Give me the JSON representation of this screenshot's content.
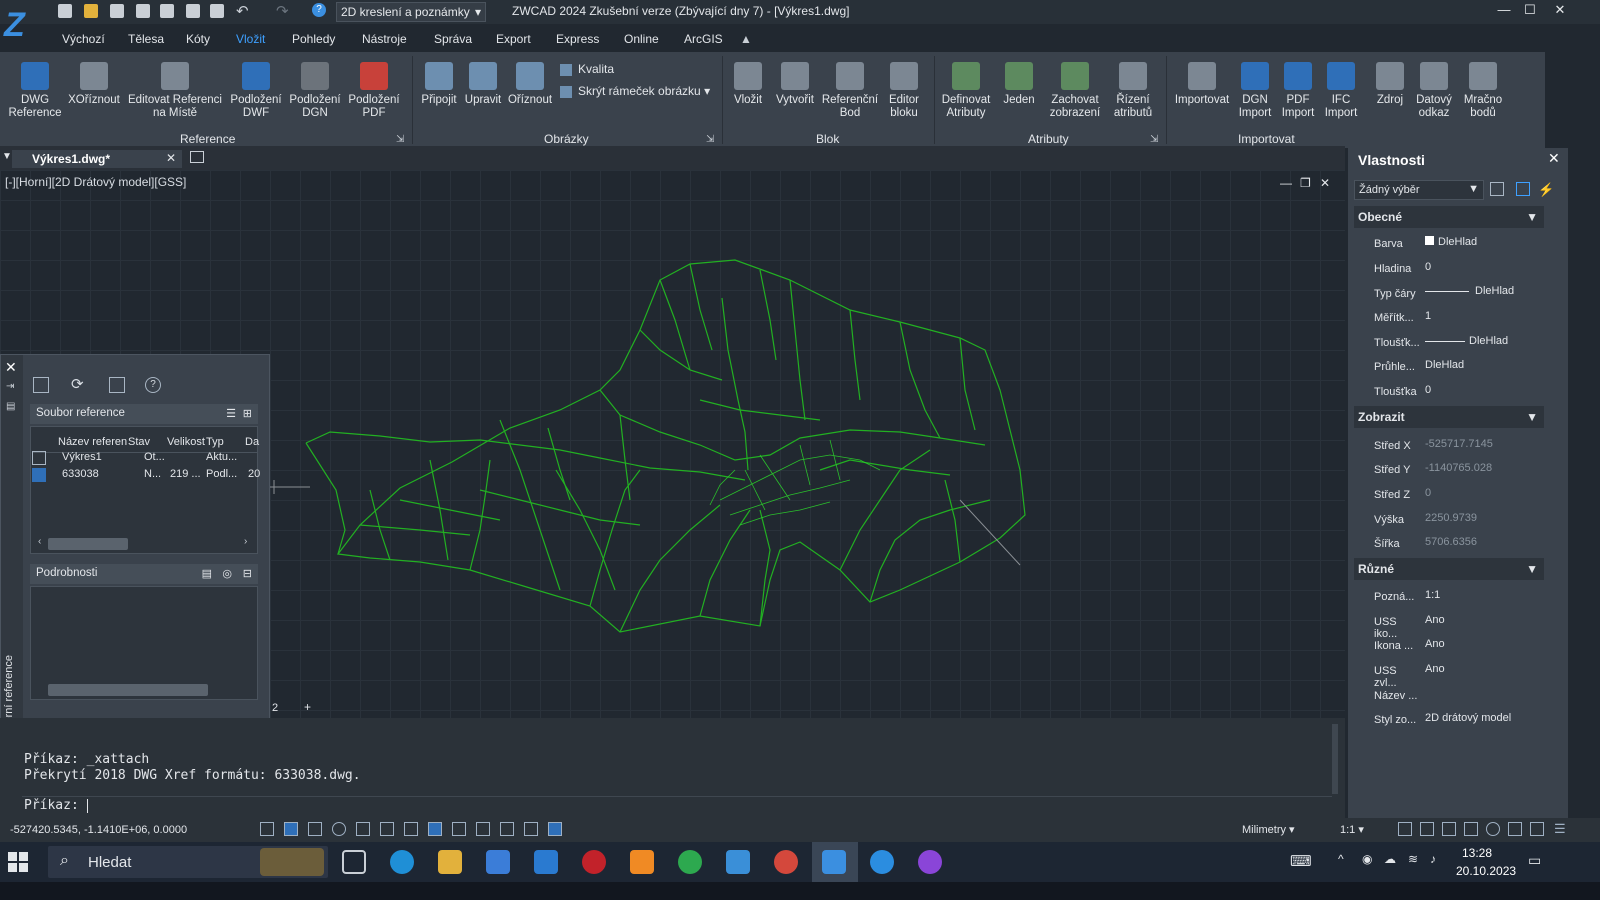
{
  "titlebar": {
    "workspace": "2D kreslení a poznámky",
    "title": "ZWCAD 2024 Zkušební verze (Zbývající dny 7) - [Výkres1.dwg]"
  },
  "menu": [
    "Výchozí",
    "Tělesa",
    "Kóty",
    "Vložit",
    "Pohledy",
    "Nástroje",
    "Správa",
    "Export",
    "Express",
    "Online",
    "ArcGIS"
  ],
  "menu_active": "Vložit",
  "ribbon": {
    "reference": {
      "title": "Reference",
      "buttons": [
        "DWG Reference",
        "XOříznout",
        "Editovat Referenci na Místě",
        "Podložení DWF",
        "Podložení DGN",
        "Podložení PDF"
      ]
    },
    "images": {
      "title": "Obrázky",
      "buttons": [
        "Připojit",
        "Upravit",
        "Oříznout"
      ],
      "small": [
        "Kvalita",
        "Skrýt rámeček obrázku"
      ]
    },
    "block": {
      "title": "Blok",
      "buttons": [
        "Vložit",
        "Vytvořit",
        "Referenční Bod",
        "Editor bloku"
      ]
    },
    "attributes": {
      "title": "Atributy",
      "buttons": [
        "Definovat Atributy",
        "Jeden",
        "Zachovat zobrazení",
        "Řízení atributů"
      ]
    },
    "import": {
      "title": "Importovat",
      "buttons": [
        "Importovat",
        "DGN Import",
        "PDF Import",
        "IFC Import",
        "Zdroj",
        "Datový odkaz",
        "Mračno bodů"
      ]
    }
  },
  "doc_tab": "Výkres1.dwg*",
  "viewport_label": "[-][Horní][2D Drátový model][GSS]",
  "layout_tab_fragment": "2",
  "xref": {
    "side_label": "Externí reference",
    "files_header": "Soubor reference",
    "columns": [
      "Název referen",
      "Stav",
      "Velikost",
      "Typ",
      "Da"
    ],
    "rows": [
      {
        "name": "Výkres1",
        "status": "Ot...",
        "size": "",
        "type": "Aktu...",
        "date": ""
      },
      {
        "name": "633038",
        "status": "N...",
        "size": "219 ...",
        "type": "Podl...",
        "date": "20"
      }
    ],
    "details_header": "Podrobnosti"
  },
  "command": {
    "lines": [
      "Příkaz: _xattach",
      "Překrytí 2018 DWG Xref formátu: 633038.dwg."
    ],
    "prompt": "Příkaz:"
  },
  "status": {
    "coords": "-527420.5345, -1.1410E+06, 0.0000",
    "units": "Milimetry",
    "scale": "1:1"
  },
  "properties": {
    "title": "Vlastnosti",
    "selection": "Žádný výběr",
    "sections": [
      {
        "name": "Obecné",
        "rows": [
          {
            "label": "Barva",
            "value": "DleHlad"
          },
          {
            "label": "Hladina",
            "value": "0"
          },
          {
            "label": "Typ čáry",
            "value": "DleHlad"
          },
          {
            "label": "Měřítk...",
            "value": "1"
          },
          {
            "label": "Tloušťk...",
            "value": "DleHlad"
          },
          {
            "label": "Průhle...",
            "value": "DleHlad"
          },
          {
            "label": "Tloušťka",
            "value": "0"
          }
        ]
      },
      {
        "name": "Zobrazit",
        "rows": [
          {
            "label": "Střed X",
            "value": "-525717.7145"
          },
          {
            "label": "Střed Y",
            "value": "-1140765.028"
          },
          {
            "label": "Střed Z",
            "value": "0"
          },
          {
            "label": "Výška",
            "value": "2250.9739"
          },
          {
            "label": "Šířka",
            "value": "5706.6356"
          }
        ]
      },
      {
        "name": "Různé",
        "rows": [
          {
            "label": "Pozná...",
            "value": "1:1"
          },
          {
            "label": "USS iko...",
            "value": "Ano"
          },
          {
            "label": "Ikona ...",
            "value": "Ano"
          },
          {
            "label": "USS zvl...",
            "value": "Ano"
          },
          {
            "label": "Název ...",
            "value": ""
          },
          {
            "label": "Styl zo...",
            "value": "2D drátový model"
          }
        ]
      }
    ]
  },
  "taskbar": {
    "search": "Hledat",
    "time": "13:28",
    "date": "20.10.2023"
  },
  "colors": {
    "accent": "#3ea0ff",
    "drawing": "#22b022",
    "background": "#212830"
  }
}
